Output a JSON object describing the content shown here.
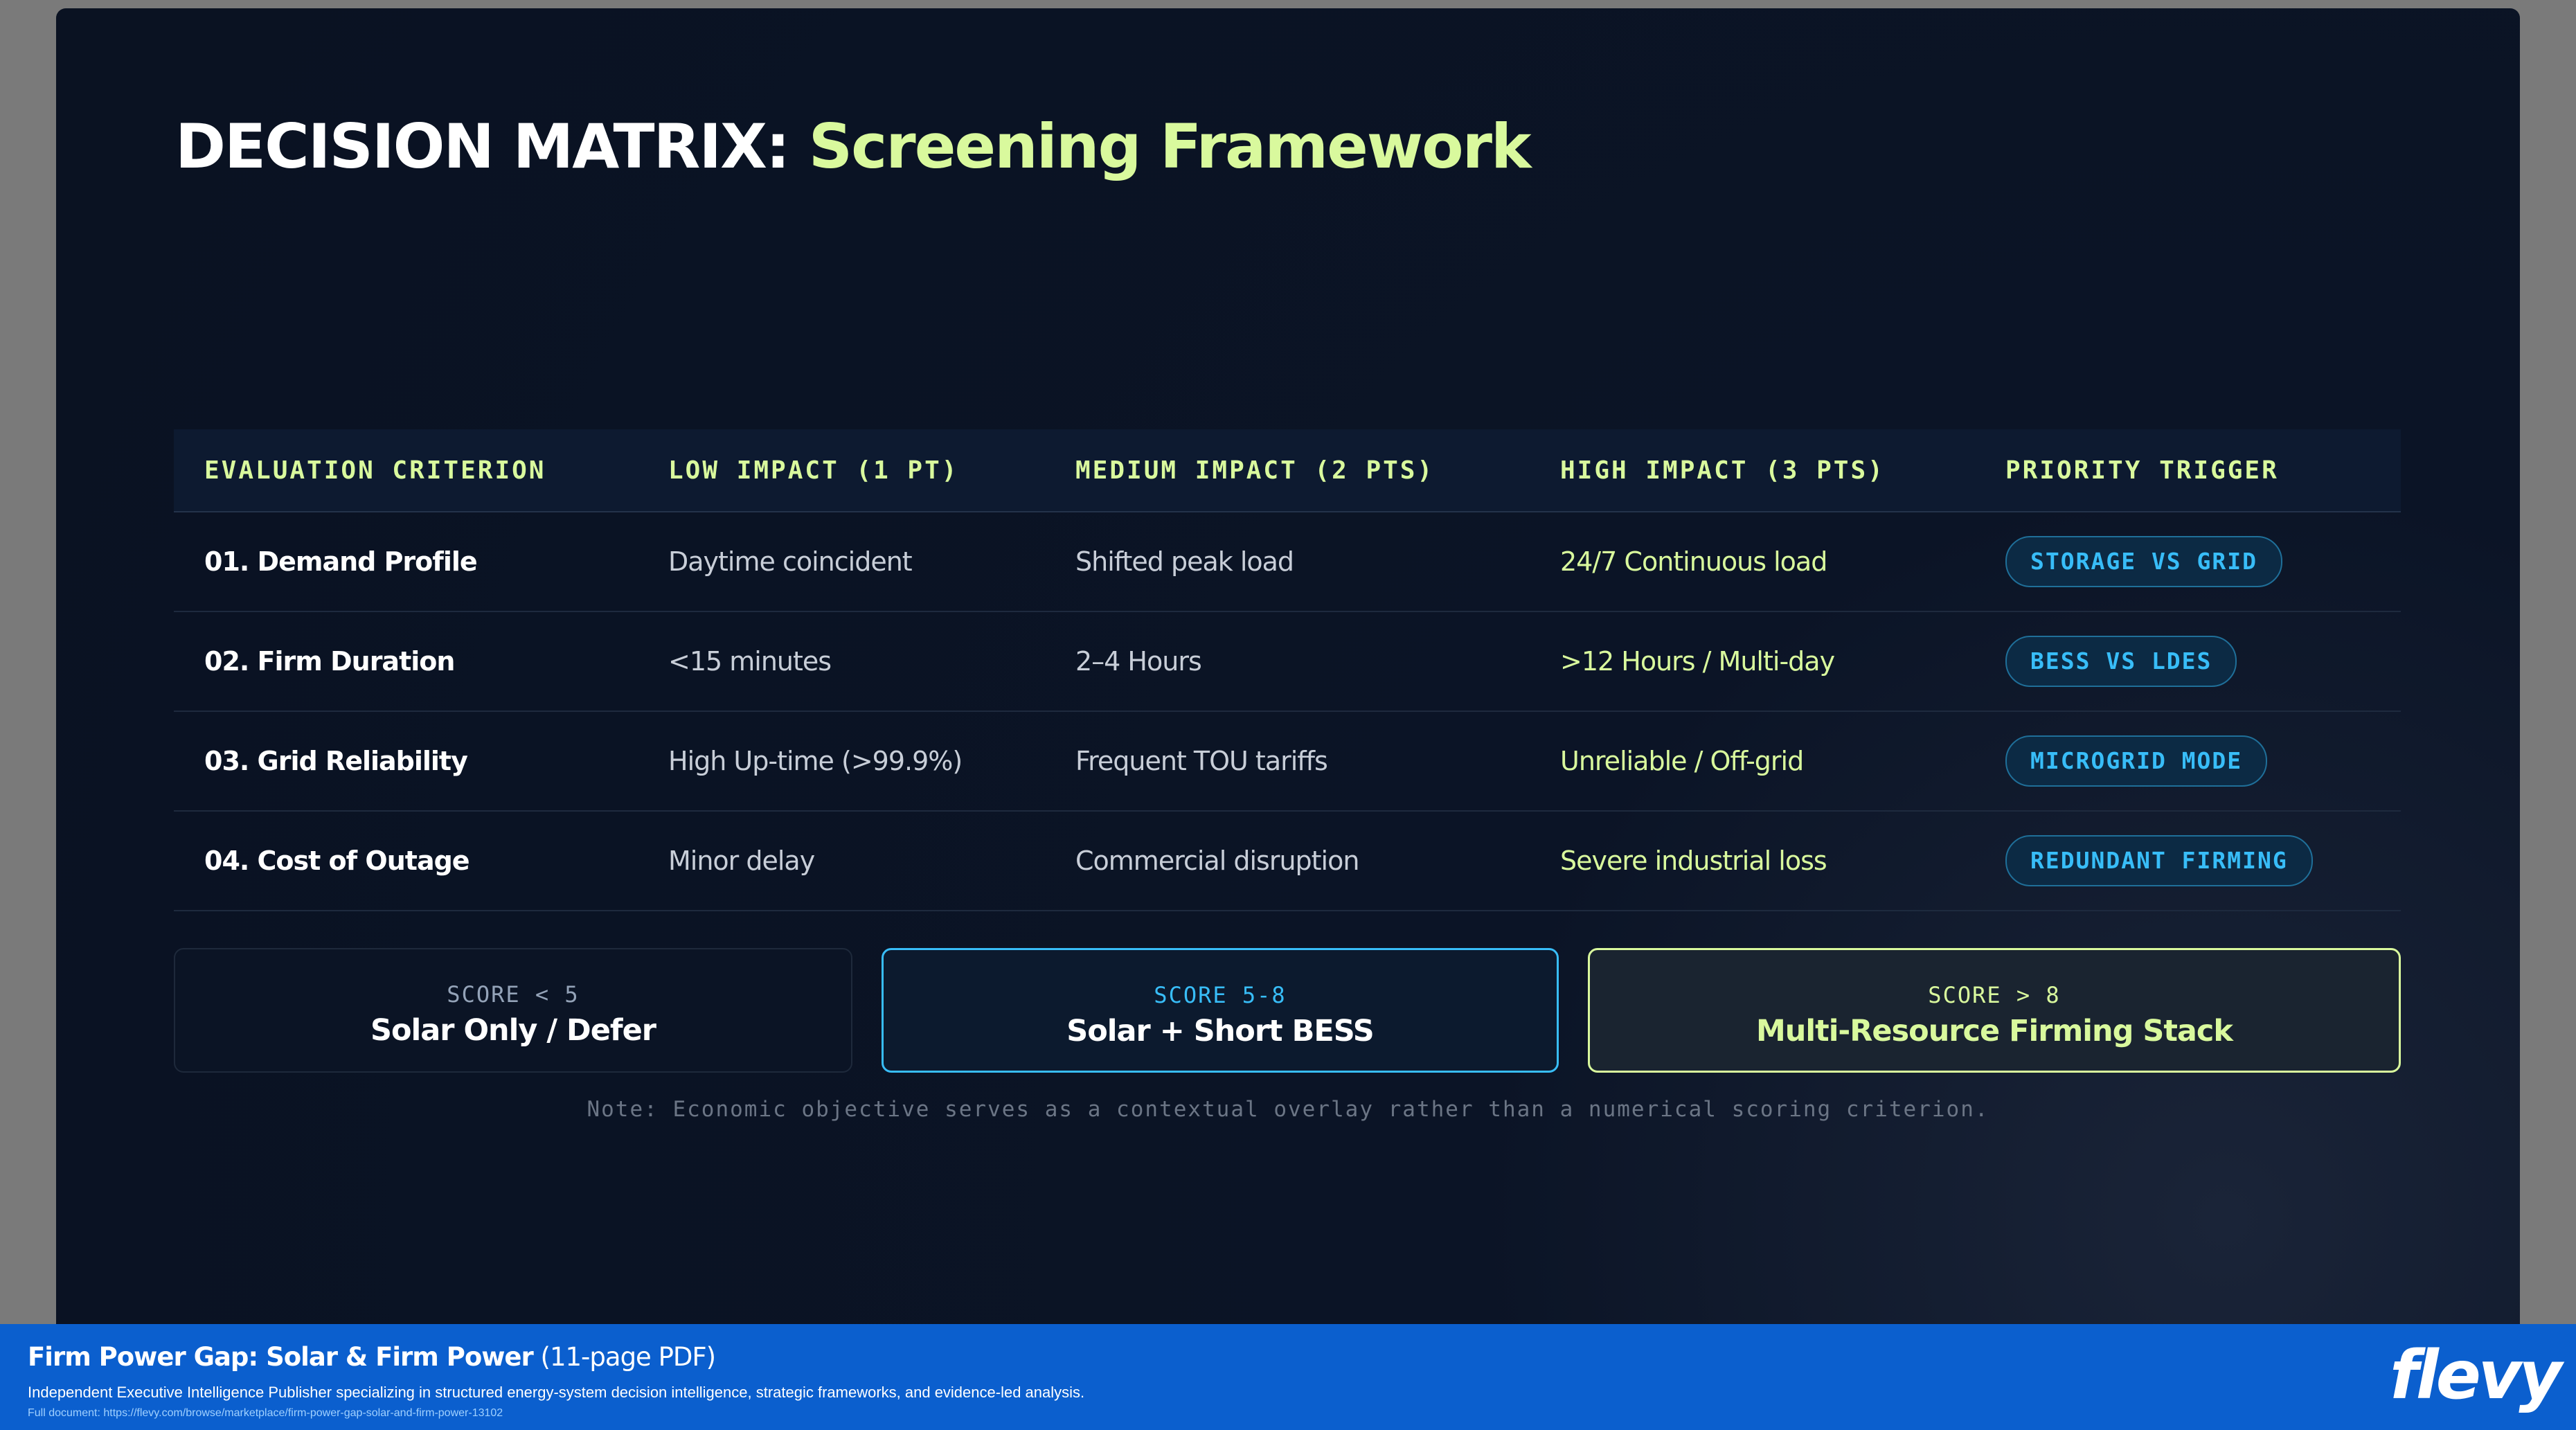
{
  "title": {
    "prefix": "DECISION MATRIX:",
    "accent": "Screening Framework"
  },
  "matrix": {
    "headers": [
      "EVALUATION CRITERION",
      "LOW IMPACT (1 PT)",
      "MEDIUM IMPACT (2 PTS)",
      "HIGH IMPACT (3 PTS)",
      "PRIORITY TRIGGER"
    ],
    "rows": [
      {
        "criterion": "01. Demand Profile",
        "low": "Daytime coincident",
        "medium": "Shifted peak load",
        "high": "24/7 Continuous load",
        "trigger": "STORAGE VS GRID"
      },
      {
        "criterion": "02. Firm Duration",
        "low": "<15 minutes",
        "medium": "2–4 Hours",
        "high": ">12 Hours / Multi-day",
        "trigger": "BESS VS LDES"
      },
      {
        "criterion": "03. Grid Reliability",
        "low": "High Up-time (>99.9%)",
        "medium": "Frequent TOU tariffs",
        "high": "Unreliable / Off-grid",
        "trigger": "MICROGRID MODE"
      },
      {
        "criterion": "04. Cost of Outage",
        "low": "Minor delay",
        "medium": "Commercial disruption",
        "high": "Severe industrial loss",
        "trigger": "REDUNDANT FIRMING"
      }
    ]
  },
  "scores": [
    {
      "label": "SCORE < 5",
      "value": "Solar Only / Defer"
    },
    {
      "label": "SCORE 5-8",
      "value": "Solar + Short BESS"
    },
    {
      "label": "SCORE > 8",
      "value": "Multi-Resource Firming Stack"
    }
  ],
  "note": "Note: Economic objective serves as a contextual overlay rather than a numerical scoring criterion.",
  "footer": {
    "title": "Firm Power Gap: Solar & Firm Power",
    "subtitle": " (11-page PDF)",
    "description": "Independent Executive Intelligence Publisher specializing in structured energy-system decision intelligence, strategic frameworks, and evidence-led analysis.",
    "url": "Full document: https://flevy.com/browse/marketplace/firm-power-gap-solar-and-firm-power-13102",
    "logo": "flevy"
  },
  "colors": {
    "accent": "#d9f99d",
    "trigger": "#38bdf8",
    "background": "#0a1222",
    "footer": "#0b5fce"
  }
}
